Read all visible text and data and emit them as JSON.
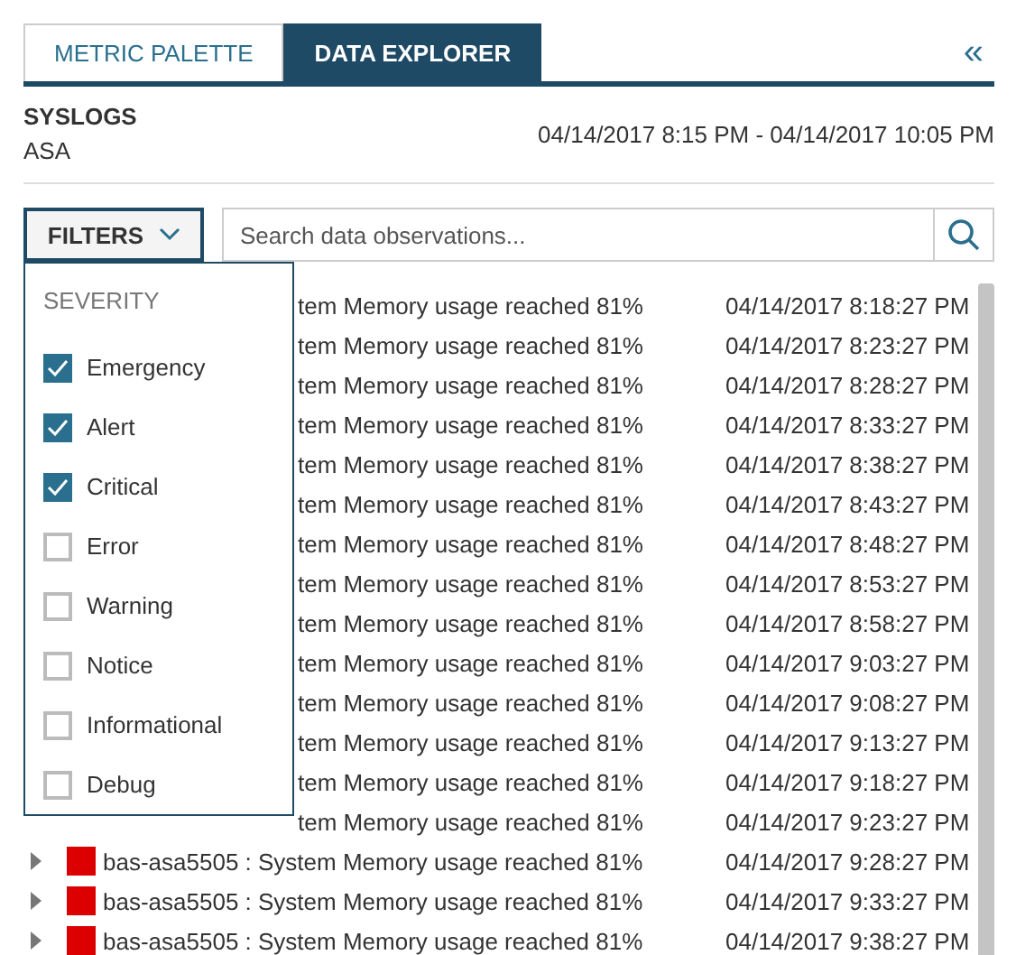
{
  "tabs": [
    {
      "label": "METRIC PALETTE",
      "selected": false
    },
    {
      "label": "DATA EXPLORER",
      "selected": true
    }
  ],
  "collapse": "«",
  "header": {
    "title": "SYSLOGS",
    "subtitle": "ASA",
    "range": "04/14/2017 8:15 PM - 04/14/2017 10:05 PM"
  },
  "filters_button": "FILTERS",
  "search": {
    "placeholder": "Search data observations..."
  },
  "filter_menu": {
    "heading": "SEVERITY",
    "options": [
      {
        "label": "Emergency",
        "checked": true
      },
      {
        "label": "Alert",
        "checked": true
      },
      {
        "label": "Critical",
        "checked": true
      },
      {
        "label": "Error",
        "checked": false
      },
      {
        "label": "Warning",
        "checked": false
      },
      {
        "label": "Notice",
        "checked": false
      },
      {
        "label": "Informational",
        "checked": false
      },
      {
        "label": "Debug",
        "checked": false
      }
    ]
  },
  "rows": [
    {
      "kind": "covered",
      "message": "tem Memory usage reached 81%",
      "time": "04/14/2017 8:18:27 PM"
    },
    {
      "kind": "covered",
      "message": "tem Memory usage reached 81%",
      "time": "04/14/2017 8:23:27 PM"
    },
    {
      "kind": "covered",
      "message": "tem Memory usage reached 81%",
      "time": "04/14/2017 8:28:27 PM"
    },
    {
      "kind": "covered",
      "message": "tem Memory usage reached 81%",
      "time": "04/14/2017 8:33:27 PM"
    },
    {
      "kind": "covered",
      "message": "tem Memory usage reached 81%",
      "time": "04/14/2017 8:38:27 PM"
    },
    {
      "kind": "covered",
      "message": "tem Memory usage reached 81%",
      "time": "04/14/2017 8:43:27 PM"
    },
    {
      "kind": "covered",
      "message": "tem Memory usage reached 81%",
      "time": "04/14/2017 8:48:27 PM"
    },
    {
      "kind": "covered",
      "message": "tem Memory usage reached 81%",
      "time": "04/14/2017 8:53:27 PM"
    },
    {
      "kind": "covered",
      "message": "tem Memory usage reached 81%",
      "time": "04/14/2017 8:58:27 PM"
    },
    {
      "kind": "covered",
      "message": "tem Memory usage reached 81%",
      "time": "04/14/2017 9:03:27 PM"
    },
    {
      "kind": "covered",
      "message": "tem Memory usage reached 81%",
      "time": "04/14/2017 9:08:27 PM"
    },
    {
      "kind": "covered",
      "message": "tem Memory usage reached 81%",
      "time": "04/14/2017 9:13:27 PM"
    },
    {
      "kind": "covered",
      "message": "tem Memory usage reached 81%",
      "time": "04/14/2017 9:18:27 PM"
    },
    {
      "kind": "covered",
      "message": "tem Memory usage reached 81%",
      "time": "04/14/2017 9:23:27 PM"
    },
    {
      "kind": "full",
      "message": "bas-asa5505 : System Memory usage reached 81%",
      "time": "04/14/2017 9:28:27 PM",
      "color": "#dd0000"
    },
    {
      "kind": "full",
      "message": "bas-asa5505 : System Memory usage reached 81%",
      "time": "04/14/2017 9:33:27 PM",
      "color": "#dd0000"
    },
    {
      "kind": "full",
      "message": "bas-asa5505 : System Memory usage reached 81%",
      "time": "04/14/2017 9:38:27 PM",
      "color": "#dd0000"
    }
  ]
}
